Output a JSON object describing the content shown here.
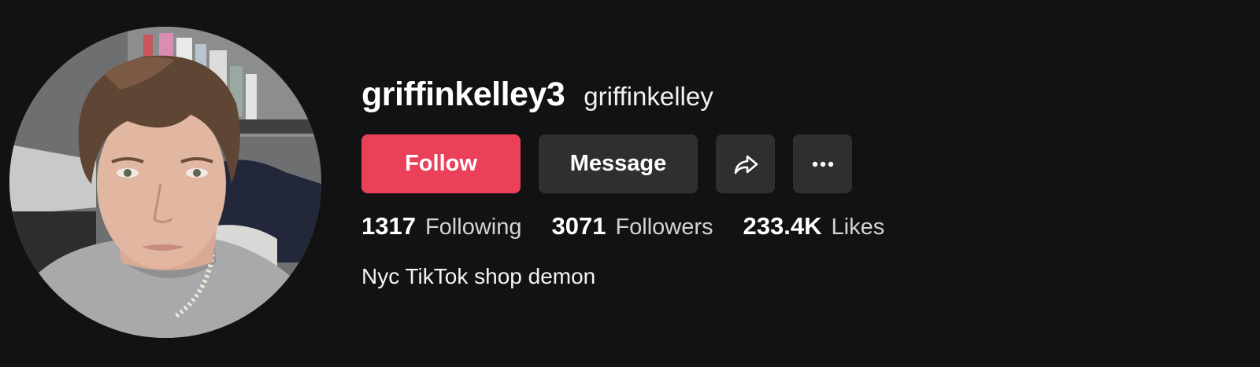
{
  "profile": {
    "username": "griffinkelley3",
    "nickname": "griffinkelley",
    "bio": "Nyc TikTok shop demon"
  },
  "actions": {
    "follow_label": "Follow",
    "message_label": "Message",
    "share_icon": "share-arrow-icon",
    "more_icon": "more-dots-icon"
  },
  "stats": [
    {
      "value": "1317",
      "label": "Following"
    },
    {
      "value": "3071",
      "label": "Followers"
    },
    {
      "value": "233.4K",
      "label": "Likes"
    }
  ],
  "colors": {
    "background": "#121212",
    "follow_button": "#ea405a",
    "secondary_button": "#2f2f2f"
  }
}
